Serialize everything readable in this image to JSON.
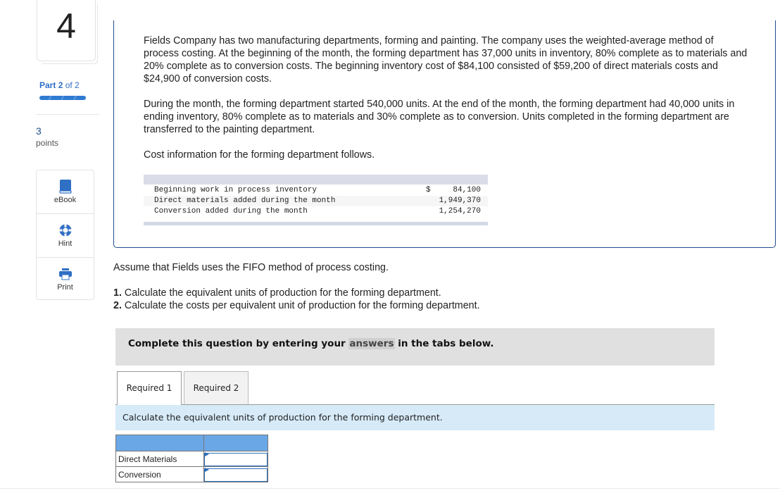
{
  "sidebar": {
    "question_number": "4",
    "part_label": "Part",
    "part_current": "2",
    "part_of": "of 2",
    "part_progress": 1.0,
    "points_value": "3",
    "points_label": "points",
    "tools": [
      {
        "label": "eBook",
        "icon": "book-icon"
      },
      {
        "label": "Hint",
        "icon": "lifebuoy-icon"
      },
      {
        "label": "Print",
        "icon": "printer-icon"
      }
    ]
  },
  "problem": {
    "paragraph1": "Fields Company has two manufacturing departments, forming and painting. The company uses the weighted-average method of process costing. At the beginning of the month, the forming department has 37,000 units in inventory, 80% complete as to materials and 20% complete as to conversion costs. The beginning inventory cost of $84,100 consisted of $59,200 of direct materials costs and $24,900 of conversion costs.",
    "paragraph2": "During the month, the forming department started 540,000 units. At the end of the month, the forming department had 40,000 units in ending inventory, 80% complete as to materials and 30% complete as to conversion. Units completed in the forming department are transferred to the painting department.",
    "paragraph3": "Cost information for the forming department follows.",
    "cost_table": [
      {
        "label": "Beginning work in process inventory",
        "currency": "$",
        "value": "84,100"
      },
      {
        "label": "Direct materials added during the month",
        "currency": "",
        "value": "1,949,370"
      },
      {
        "label": "Conversion added during the month",
        "currency": "",
        "value": "1,254,270"
      }
    ]
  },
  "assume": "Assume that Fields uses the FIFO method of process costing.",
  "requirements": [
    {
      "num": "1.",
      "text": " Calculate the equivalent units of production for the forming department."
    },
    {
      "num": "2.",
      "text": " Calculate the costs per equivalent unit of production for the forming department."
    }
  ],
  "instructions": {
    "before": "Complete this question by entering your ",
    "highlight": "answers",
    "after": " in the tabs below."
  },
  "tabs": [
    {
      "label": "Required 1",
      "active": true
    },
    {
      "label": "Required 2",
      "active": false
    }
  ],
  "prompt": "Calculate the equivalent units of production for the forming department.",
  "answer_table": {
    "rows": [
      {
        "label": "Direct Materials",
        "value": ""
      },
      {
        "label": "Conversion",
        "value": ""
      }
    ]
  }
}
